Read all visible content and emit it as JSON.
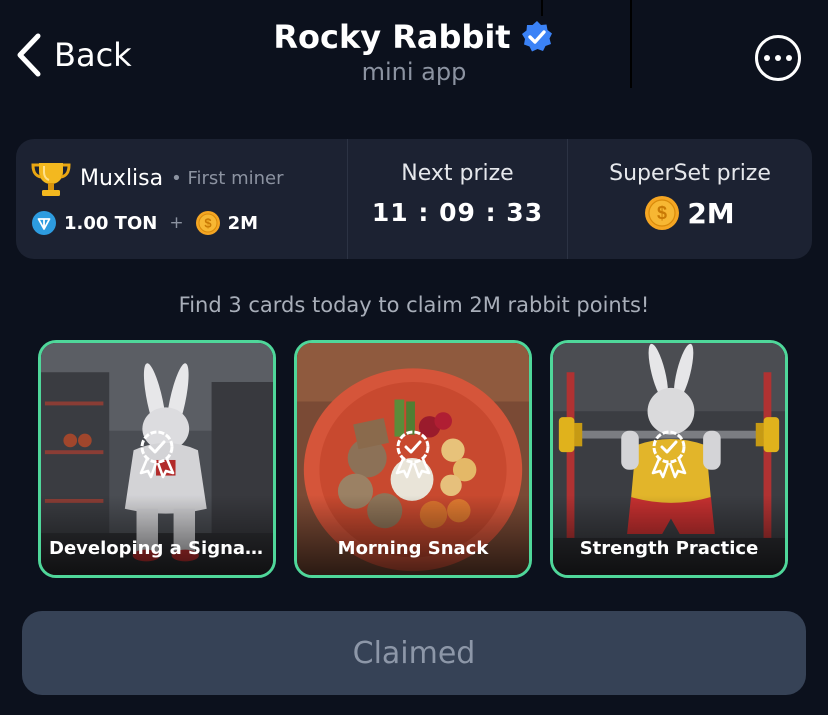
{
  "header": {
    "back_label": "Back",
    "title": "Rocky Rabbit",
    "subtitle": "mini app"
  },
  "miner": {
    "name": "Muxlisa",
    "role": "• First miner",
    "ton_reward": "1.00 TON",
    "plus": "+",
    "coin_reward": "2M"
  },
  "next_prize": {
    "label": "Next prize",
    "countdown": "11 : 09 : 33"
  },
  "superset": {
    "label": "SuperSet prize",
    "value": "2M"
  },
  "hint": "Find 3 cards today to claim 2M rabbit points!",
  "cards": [
    {
      "label": "Developing a Signa..."
    },
    {
      "label": "Morning Snack"
    },
    {
      "label": "Strength Practice"
    }
  ],
  "claim_button": {
    "label": "Claimed"
  },
  "colors": {
    "background": "#0c111d",
    "panel": "#1c2232",
    "card_border": "#4fd79a",
    "button": "#364256",
    "verified_badge": "#3b82f6",
    "coin": "#f5a623"
  },
  "icons": {
    "back": "chevron-left-icon",
    "verified": "verified-check-icon",
    "more": "more-dots-icon",
    "trophy": "trophy-icon",
    "ton": "ton-icon",
    "coin": "dollar-coin-icon",
    "card_badge": "award-check-icon"
  }
}
